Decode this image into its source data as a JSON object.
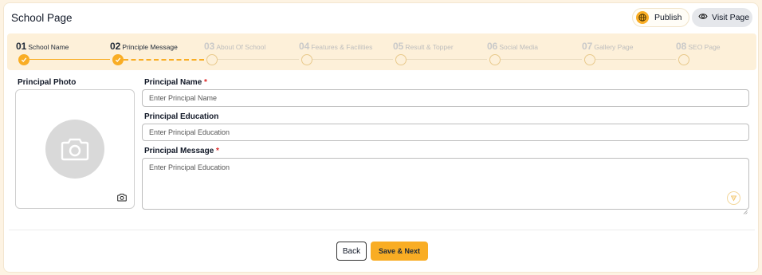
{
  "header": {
    "title": "School Page",
    "publish_label": "Publish",
    "visit_label": "Visit Page"
  },
  "steps": [
    {
      "num": "01",
      "label": "School Name",
      "status": "done"
    },
    {
      "num": "02",
      "label": "Principle Message",
      "status": "done"
    },
    {
      "num": "03",
      "label": "About Of School",
      "status": "todo"
    },
    {
      "num": "04",
      "label": "Features & Facilities",
      "status": "todo"
    },
    {
      "num": "05",
      "label": "Result & Topper",
      "status": "todo"
    },
    {
      "num": "06",
      "label": "Social Media",
      "status": "todo"
    },
    {
      "num": "07",
      "label": "Gallery Page",
      "status": "todo"
    },
    {
      "num": "08",
      "label": "SEO Page",
      "status": "todo"
    }
  ],
  "form": {
    "photo_label": "Principal Photo",
    "name_label": "Principal Name",
    "name_placeholder": "Enter Principal Name",
    "education_label": "Principal Education",
    "education_placeholder": "Enter Principal Education",
    "message_label": "Principal Message",
    "message_placeholder": "Enter Principal Education",
    "required_mark": "*"
  },
  "footer": {
    "back_label": "Back",
    "save_label": "Save & Next"
  },
  "colors": {
    "accent": "#f9ad24",
    "stepper_bg": "#fdf0d9",
    "required": "#dc2626"
  }
}
